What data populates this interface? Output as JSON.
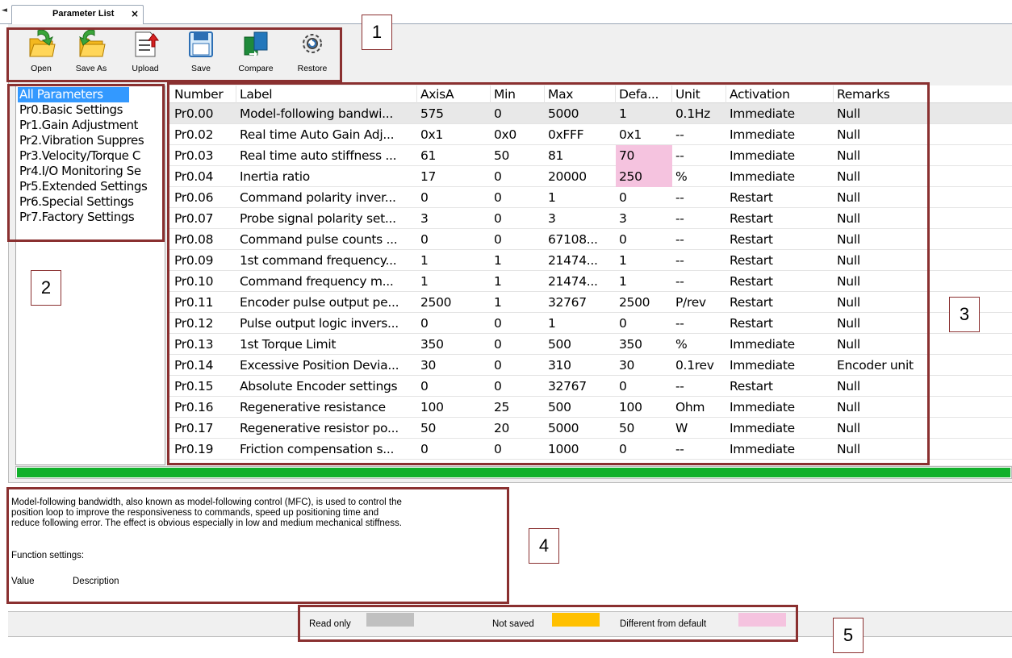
{
  "tab": {
    "title": "Parameter List",
    "close": "×",
    "arrow": "◄"
  },
  "toolbar": [
    {
      "id": "open",
      "label": "Open",
      "icon": "open-folder-icon"
    },
    {
      "id": "save-as",
      "label": "Save As",
      "icon": "save-as-folder-icon"
    },
    {
      "id": "upload",
      "label": "Upload",
      "icon": "upload-icon"
    },
    {
      "id": "save",
      "label": "Save",
      "icon": "floppy-disk-icon"
    },
    {
      "id": "compare",
      "label": "Compare",
      "icon": "compare-icon"
    },
    {
      "id": "restore",
      "label": "Restore",
      "icon": "gear-restore-icon"
    }
  ],
  "tree": {
    "selected": 0,
    "items": [
      "All Parameters",
      "Pr0.Basic Settings",
      "Pr1.Gain Adjustment",
      "Pr2.Vibration Suppres",
      "Pr3.Velocity/Torque C",
      "Pr4.I/O Monitoring Se",
      "Pr5.Extended Settings",
      "Pr6.Special Settings",
      "Pr7.Factory Settings"
    ]
  },
  "grid": {
    "columns": [
      "Number",
      "Label",
      "AxisA",
      "Min",
      "Max",
      "Defa...",
      "Unit",
      "Activation",
      "Remarks"
    ],
    "rows": [
      [
        "Pr0.00",
        "Model-following bandwi...",
        "575",
        "0",
        "5000",
        "1",
        "0.1Hz",
        "Immediate",
        "Null"
      ],
      [
        "Pr0.02",
        "Real time Auto Gain Adj...",
        "0x1",
        "0x0",
        "0xFFF",
        "0x1",
        "--",
        "Immediate",
        "Null"
      ],
      [
        "Pr0.03",
        "Real time auto stiffness ...",
        "61",
        "50",
        "81",
        "70",
        "--",
        "Immediate",
        "Null"
      ],
      [
        "Pr0.04",
        "Inertia ratio",
        "17",
        "0",
        "20000",
        "250",
        "%",
        "Immediate",
        "Null"
      ],
      [
        "Pr0.06",
        "Command polarity inver...",
        "0",
        "0",
        "1",
        "0",
        "--",
        "Restart",
        "Null"
      ],
      [
        "Pr0.07",
        "Probe signal polarity set...",
        "3",
        "0",
        "3",
        "3",
        "--",
        "Restart",
        "Null"
      ],
      [
        "Pr0.08",
        "Command pulse counts ...",
        "0",
        "0",
        "67108...",
        "0",
        "--",
        "Restart",
        "Null"
      ],
      [
        "Pr0.09",
        "1st command frequency...",
        "1",
        "1",
        "21474...",
        "1",
        "--",
        "Restart",
        "Null"
      ],
      [
        "Pr0.10",
        "Command frequency m...",
        "1",
        "1",
        "21474...",
        "1",
        "--",
        "Restart",
        "Null"
      ],
      [
        "Pr0.11",
        "Encoder pulse output pe...",
        "2500",
        "1",
        "32767",
        "2500",
        "P/rev",
        "Restart",
        "Null"
      ],
      [
        "Pr0.12",
        "Pulse output logic invers...",
        "0",
        "0",
        "1",
        "0",
        "--",
        "Restart",
        "Null"
      ],
      [
        "Pr0.13",
        "1st Torque Limit",
        "350",
        "0",
        "500",
        "350",
        "%",
        "Immediate",
        "Null"
      ],
      [
        "Pr0.14",
        "Excessive Position Devia...",
        "30",
        "0",
        "310",
        "30",
        "0.1rev",
        "Immediate",
        "Encoder unit"
      ],
      [
        "Pr0.15",
        "Absolute Encoder settings",
        "0",
        "0",
        "32767",
        "0",
        "--",
        "Restart",
        "Null"
      ],
      [
        "Pr0.16",
        "Regenerative resistance",
        "100",
        "25",
        "500",
        "100",
        "Ohm",
        "Immediate",
        "Null"
      ],
      [
        "Pr0.17",
        "Regenerative resistor po...",
        "50",
        "20",
        "5000",
        "50",
        "W",
        "Immediate",
        "Null"
      ],
      [
        "Pr0.19",
        "Friction compensation s...",
        "0",
        "0",
        "1000",
        "0",
        "--",
        "Immediate",
        "Null"
      ]
    ],
    "highlight_rows_default": [
      2,
      3
    ],
    "highlight_color": "#f5c3df"
  },
  "progress": {
    "value": 1.0,
    "color": "#10b02a"
  },
  "description": {
    "intro": "Model-following bandwidth, also known as model-following control (MFC), is used to control the\nposition loop to improve the responsiveness to commands, speed up positioning time and\nreduce following error. The effect is obvious especially in low and medium mechanical stiffness.",
    "function_settings": "Function settings:",
    "value_header": "Value",
    "description_header": "Description"
  },
  "legend": [
    {
      "label": "Read only",
      "color": "#c0c0c0"
    },
    {
      "label": "Not saved",
      "color": "#ffc000"
    },
    {
      "label": "Different from default",
      "color": "#f5c3df"
    }
  ],
  "annotations": [
    "1",
    "2",
    "3",
    "4",
    "5"
  ],
  "colors": {
    "annotation": "#8a3030",
    "selection": "#3399ff"
  }
}
